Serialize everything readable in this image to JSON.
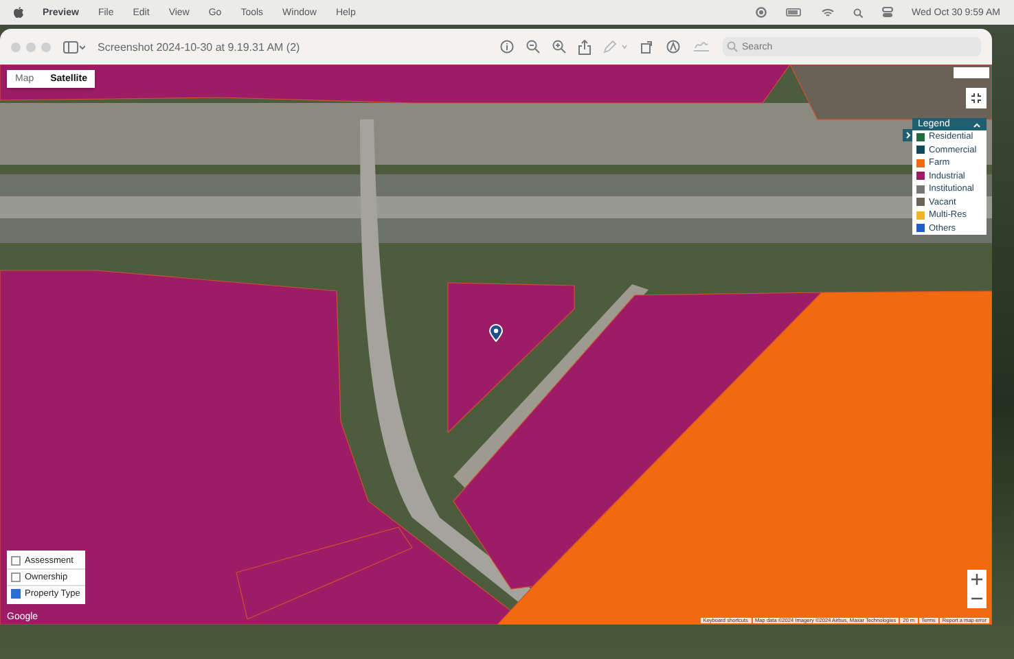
{
  "menu_bar": {
    "app": "Preview",
    "items": [
      "File",
      "Edit",
      "View",
      "Go",
      "Tools",
      "Window",
      "Help"
    ],
    "clock": "Wed Oct 30  9:59 AM"
  },
  "window": {
    "title": "Screenshot 2024-10-30 at 9.19.31 AM (2)",
    "search": {
      "placeholder": "Search"
    }
  },
  "map": {
    "map_type_tabs": [
      {
        "label": "Map",
        "selected": false
      },
      {
        "label": "Satellite",
        "selected": true
      }
    ],
    "legend": {
      "title": "Legend",
      "expanded": true,
      "items": [
        {
          "label": "Residential",
          "color": "#1e6b3c"
        },
        {
          "label": "Commercial",
          "color": "#0d4a5e"
        },
        {
          "label": "Farm",
          "color": "#f26a10"
        },
        {
          "label": "Industrial",
          "color": "#9c1c66"
        },
        {
          "label": "Institutional",
          "color": "#777777"
        },
        {
          "label": "Vacant",
          "color": "#6b6358"
        },
        {
          "label": "Multi-Res",
          "color": "#f0b429"
        },
        {
          "label": "Others",
          "color": "#1f5fc8"
        }
      ]
    },
    "layers": [
      {
        "label": "Assessment",
        "checked": false
      },
      {
        "label": "Ownership",
        "checked": false
      },
      {
        "label": "Property Type",
        "checked": true
      }
    ],
    "logo": "Google",
    "attribution": [
      "Keyboard shortcuts",
      "Map data ©2024 Imagery ©2024 Airbus, Maxar Technologies",
      "20 m",
      "Terms",
      "Report a map error"
    ]
  }
}
